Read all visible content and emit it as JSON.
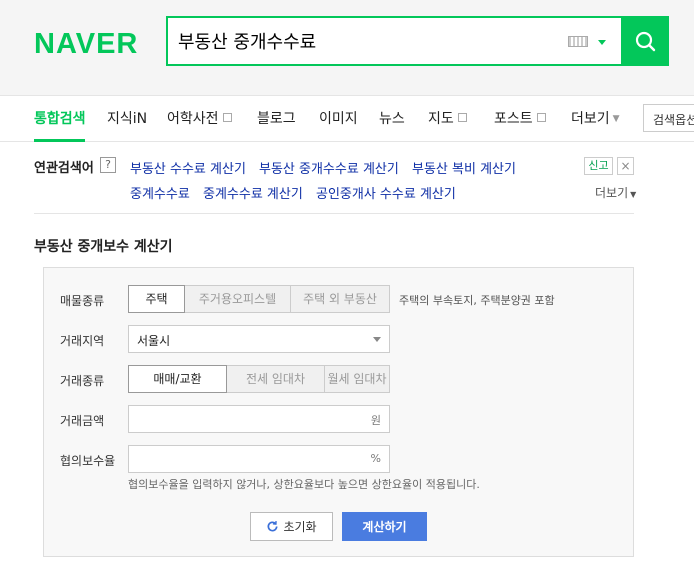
{
  "header": {
    "logo": "NAVER",
    "search_value": "부동산 중개수수료"
  },
  "nav": {
    "items": [
      {
        "label": "통합검색"
      },
      {
        "label": "지식iN"
      },
      {
        "label": "어학사전"
      },
      {
        "label": "블로그"
      },
      {
        "label": "이미지"
      },
      {
        "label": "뉴스"
      },
      {
        "label": "지도"
      },
      {
        "label": "포스트"
      },
      {
        "label": "더보기"
      }
    ],
    "search_option": "검색옵션"
  },
  "related": {
    "label": "연관검색어",
    "help": "?",
    "links": [
      "부동산 수수료 계산기",
      "부동산 중개수수료 계산기",
      "부동산 복비 계산기",
      "중계수수료",
      "중계수수료 계산기",
      "공인중개사 수수료 계산기"
    ],
    "report": "신고",
    "close": "×",
    "more": "더보기"
  },
  "calculator": {
    "title": "부동산 중개보수 계산기",
    "property_type": {
      "label": "매물종류",
      "options": [
        "주택",
        "주거용오피스텔",
        "주택 외 부동산"
      ],
      "selected": "주택",
      "hint": "주택의 부속토지, 주택분양권 포함"
    },
    "region": {
      "label": "거래지역",
      "value": "서울시"
    },
    "trade_type": {
      "label": "거래종류",
      "options": [
        "매매/교환",
        "전세 임대차",
        "월세 임대차"
      ],
      "selected": "매매/교환"
    },
    "amount": {
      "label": "거래금액",
      "unit": "원"
    },
    "rate": {
      "label": "협의보수율",
      "unit": "%",
      "note": "협의보수율을 입력하지 않거나, 상한요율보다 높으면 상한요율이 적용됩니다."
    },
    "reset_label": "초기화",
    "calc_label": "계산하기"
  },
  "colors": {
    "brand": "#03c75a",
    "link": "#0f2fa6",
    "calc_button": "#4a7ce0"
  }
}
